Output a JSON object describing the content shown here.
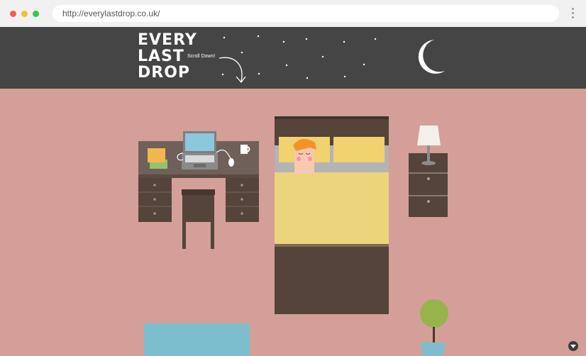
{
  "browser": {
    "url": "http://everylastdrop.co.uk/"
  },
  "header": {
    "logo_lines": [
      "EVERY",
      "LAST",
      "DROP"
    ],
    "scroll_hint": "Scroll Down!"
  },
  "colors": {
    "night_bg": "#454545",
    "room_bg": "#d49f98",
    "furniture": "#54443a",
    "blanket": "#ecd47c",
    "pillow": "#f0d26e",
    "rug": "#7cbecd",
    "plant": "#97b34b"
  },
  "icons": {
    "moon": "moon-icon",
    "scroll_down": "down-arrow-icon"
  }
}
